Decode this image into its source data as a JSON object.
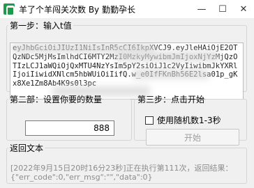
{
  "window": {
    "title": "羊了个羊闯关次数 By 勤勤孕长",
    "minimize_glyph": "—",
    "maximize_glyph": "☐",
    "close_glyph": "✕"
  },
  "step1": {
    "legend": "第一步：输入t值",
    "token_text": "eyJhbGciOiJIUzI1NiIsInR5cCI6IkpXVCJ9.eyJleHAiOjE2OTQzNDc5MjMsImlhdCI6MTY2MzI0MzkyMywibmJmIjoxNjYzMjQzOTIzLCJ1aWQiOjQxMTU4NzYsIm5pY2siOiJ1c2VyIiwibmJkYXRlIjoiIiwidXNlcm5hbWUiOiIifQ.w_e0IfFKnBh56E2lsa01p_gKx8Xe1Zm8Ab4K9s0l3pc"
  },
  "step2": {
    "legend": "第二部：设置你要的数量",
    "count_value": "888"
  },
  "step3": {
    "legend": "第三步：点击开始",
    "random_checkbox_label": "使用随机数1-3秒",
    "random_checked": false,
    "start_button_label": "开始"
  },
  "result": {
    "legend": "返回文本",
    "log_text": "[2022年9月15日20时16分23秒]正在执行第111次，返回结果：{\"err_code\":0,\"err_msg\":\"\",\"data\":0}"
  }
}
